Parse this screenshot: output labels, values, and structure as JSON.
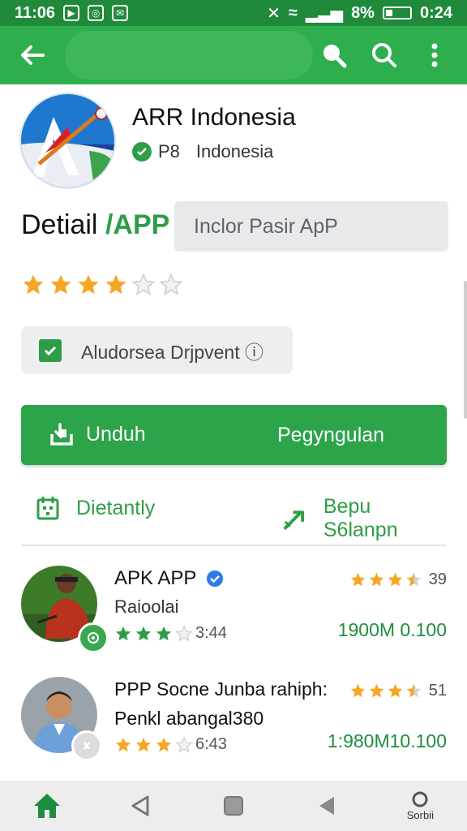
{
  "status_bar": {
    "time_left": "11:06",
    "battery": "8%",
    "time_right": "0:24"
  },
  "app": {
    "title": "ARR Indonesia",
    "developer_prefix": "P8",
    "developer_name": "Indonesia"
  },
  "detail": {
    "title_plain": "Detiail ",
    "title_accent": "/APP",
    "search_placeholder": "Inclor Pasir ApP"
  },
  "rating": {
    "value": 4,
    "max": 6
  },
  "chip": {
    "label": "Aludorsea Drjpvent ⓘ"
  },
  "primary_button": {
    "left_label": "Unduh",
    "right_label": "Pegyngulan"
  },
  "secondary": {
    "left_label": "Dietantly",
    "right_label": "Bepu S6lanpn"
  },
  "list": [
    {
      "title": "APK APP",
      "subtitle": "Raioolai",
      "stars_filled": 3,
      "stars_total": 4,
      "stars_caption": "3:44",
      "top_rating": 3.5,
      "top_rating_text": "39",
      "size": "1900M 0.100"
    },
    {
      "title": "PPP Socne Junba rahiph:",
      "subtitle": "Penkl abangal380",
      "stars_filled": 3,
      "stars_total": 4,
      "stars_caption": "6:43",
      "top_rating": 3.5,
      "top_rating_text": "51",
      "size": "1:980M10.100"
    }
  ],
  "navbar": {
    "right_label": "Sorbii"
  },
  "colors": {
    "appbar": "#2fae4e",
    "statusbar": "#1f8a3a",
    "accent": "#2e9d48",
    "star": "#f5a623",
    "star_empty": "#d3d3d3"
  },
  "icons": {
    "back": "arrow-left-icon",
    "search": "search-icon",
    "more": "more-vertical-icon",
    "download": "download-icon",
    "check": "check-icon",
    "share": "share-arrow-icon",
    "calendar": "calendar-icon"
  }
}
